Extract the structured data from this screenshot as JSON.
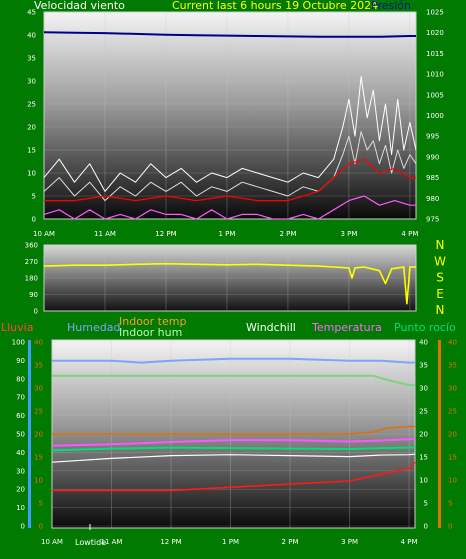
{
  "header": {
    "wind_label": "Velocidad viento",
    "title": "Current last 6 hours 19 Octubre 2024",
    "pressure_label": "Presión"
  },
  "colors": {
    "background": "#007a00",
    "wind": "#ffffff",
    "gust": "#ffffff",
    "wind_low": "#ff55ff",
    "pressure": "#00008b",
    "direction": "#ffff00",
    "avg_line": "#ff0000",
    "humidity": "#7fa3ff",
    "indoor_temp": "#e07000",
    "indoor_hum": "#7fd27f",
    "windchill": "#ffffff",
    "temperature": "#ff55ff",
    "dew_point": "#00e07a",
    "rain_axis": "#ff4444",
    "temp_axis": "#e07000"
  },
  "chart_data": [
    {
      "type": "line",
      "name": "wind-panel",
      "title": "Current last 6 hours 19 Octubre 2024",
      "x_ticks": [
        "10 AM",
        "11 AM",
        "12 PM",
        "1 PM",
        "2 PM",
        "3 PM",
        "4 PM"
      ],
      "y_left": {
        "label": "Velocidad viento",
        "ticks": [
          "45",
          "40",
          "35",
          "30",
          "25",
          "20",
          "15",
          "10",
          "5",
          "0"
        ],
        "lim": [
          0,
          45
        ]
      },
      "y_right": {
        "label": "Presión",
        "ticks": [
          "1025",
          "1020",
          "1015",
          "1010",
          "1005",
          "1000",
          "995",
          "990",
          "985",
          "980",
          "975"
        ],
        "lim": [
          975,
          1025
        ]
      },
      "series": [
        {
          "name": "Presión",
          "axis": "right",
          "x": [
            10,
            10.5,
            11,
            11.5,
            12,
            12.5,
            13,
            13.5,
            14,
            14.5,
            15,
            15.5,
            16,
            16.1
          ],
          "values": [
            1020.1,
            1020.0,
            1019.9,
            1019.7,
            1019.5,
            1019.4,
            1019.3,
            1019.2,
            1019.1,
            1019.0,
            1019.0,
            1019.0,
            1019.2,
            1019.2
          ]
        },
        {
          "name": "Racha",
          "axis": "left",
          "x": [
            10,
            10.25,
            10.5,
            10.75,
            11,
            11.25,
            11.5,
            11.75,
            12,
            12.25,
            12.5,
            12.75,
            13,
            13.25,
            13.5,
            13.75,
            14,
            14.25,
            14.5,
            14.75,
            14.9,
            15.0,
            15.1,
            15.2,
            15.3,
            15.4,
            15.5,
            15.6,
            15.7,
            15.8,
            15.9,
            16,
            16.1
          ],
          "values": [
            9,
            13,
            8,
            12,
            6,
            10,
            8,
            12,
            9,
            11,
            8,
            10,
            9,
            11,
            10,
            9,
            8,
            10,
            9,
            13,
            20,
            26,
            18,
            31,
            22,
            28,
            17,
            25,
            14,
            26,
            15,
            21,
            15
          ]
        },
        {
          "name": "Velocidad media",
          "axis": "left",
          "x": [
            10,
            10.25,
            10.5,
            10.75,
            11,
            11.25,
            11.5,
            11.75,
            12,
            12.25,
            12.5,
            12.75,
            13,
            13.25,
            13.5,
            13.75,
            14,
            14.25,
            14.5,
            14.75,
            14.9,
            15.0,
            15.1,
            15.2,
            15.3,
            15.4,
            15.5,
            15.6,
            15.7,
            15.8,
            15.9,
            16,
            16.1
          ],
          "values": [
            6,
            9,
            5,
            8,
            4,
            7,
            5,
            8,
            6,
            8,
            5,
            7,
            6,
            8,
            7,
            6,
            5,
            7,
            6,
            9,
            14,
            18,
            12,
            19,
            15,
            17,
            12,
            16,
            10,
            15,
            11,
            14,
            12
          ]
        },
        {
          "name": "Promedio",
          "axis": "left",
          "x": [
            10,
            10.5,
            11,
            11.5,
            12,
            12.5,
            13,
            13.5,
            14,
            14.5,
            14.75,
            15,
            15.25,
            15.5,
            15.75,
            16,
            16.1
          ],
          "values": [
            4,
            4,
            5,
            4,
            5,
            4,
            5,
            4,
            4,
            6,
            9,
            12,
            13,
            10,
            11,
            9,
            9
          ]
        },
        {
          "name": "Mínimo",
          "axis": "left",
          "x": [
            10,
            10.25,
            10.5,
            10.75,
            11,
            11.25,
            11.5,
            11.75,
            12,
            12.25,
            12.5,
            12.75,
            13,
            13.25,
            13.5,
            13.75,
            14,
            14.25,
            14.5,
            14.75,
            15,
            15.25,
            15.5,
            15.75,
            16,
            16.1
          ],
          "values": [
            1,
            2,
            0,
            2,
            0,
            1,
            0,
            2,
            1,
            1,
            0,
            2,
            0,
            1,
            1,
            0,
            0,
            1,
            0,
            2,
            4,
            5,
            3,
            4,
            3,
            3
          ]
        }
      ]
    },
    {
      "type": "line",
      "name": "direction-panel",
      "x_ticks": [
        "10 AM",
        "11 AM",
        "12 PM",
        "1 PM",
        "2 PM",
        "3 PM",
        "4 PM"
      ],
      "y_left": {
        "ticks": [
          "360",
          "270",
          "180",
          "90",
          "0"
        ],
        "lim": [
          0,
          360
        ]
      },
      "y_right": {
        "ticks": [
          "N",
          "W",
          "S",
          "E",
          "N"
        ]
      },
      "series": [
        {
          "name": "Dirección",
          "x": [
            10,
            10.5,
            11,
            11.5,
            12,
            12.5,
            13,
            13.5,
            14,
            14.5,
            14.75,
            15,
            15.05,
            15.1,
            15.25,
            15.5,
            15.6,
            15.7,
            15.8,
            15.9,
            15.95,
            16,
            16.1
          ],
          "values": [
            245,
            250,
            250,
            255,
            258,
            255,
            252,
            255,
            250,
            245,
            240,
            235,
            180,
            235,
            240,
            220,
            150,
            230,
            235,
            240,
            40,
            240,
            240
          ]
        }
      ]
    },
    {
      "type": "line",
      "name": "temp-hum-panel",
      "x_ticks": [
        "10 AM",
        "11 AM",
        "12 PM",
        "1 PM",
        "2 PM",
        "3 PM",
        "4 PM"
      ],
      "lowtide_label": "Lowtide",
      "y_axes": {
        "rain": {
          "label": "Lluvia",
          "ticks": [
            "30",
            "25",
            "20",
            "15",
            "10",
            "5",
            "0"
          ],
          "lim": [
            0,
            30
          ]
        },
        "humidity": {
          "label": "Humedad",
          "ticks": [
            "100",
            "90",
            "80",
            "70",
            "60",
            "50",
            "40",
            "30",
            "20",
            "10",
            "0"
          ],
          "lim": [
            0,
            100
          ]
        },
        "temp_left": {
          "ticks": [
            "40",
            "35",
            "30",
            "25",
            "20",
            "15",
            "10",
            "5",
            "0"
          ],
          "lim": [
            0,
            40
          ]
        },
        "temp_right": {
          "ticks": [
            "40",
            "35",
            "30",
            "25",
            "20",
            "15",
            "10",
            "5",
            "0"
          ],
          "lim": [
            0,
            40
          ]
        }
      },
      "legend": [
        "Humedad",
        "Indoor temp",
        "Indoor hum",
        "Windchill",
        "Temperatura",
        "Punto rocío"
      ],
      "series": [
        {
          "name": "Humedad",
          "axis": "humidity",
          "x": [
            10,
            11,
            11.5,
            12,
            13,
            14,
            15,
            15.5,
            16,
            16.1
          ],
          "values": [
            89,
            89,
            88,
            89,
            90,
            90,
            89,
            89,
            88,
            88
          ]
        },
        {
          "name": "Indoor hum",
          "axis": "humidity",
          "x": [
            10,
            11,
            12,
            13,
            14,
            15,
            15.4,
            15.6,
            16,
            16.1
          ],
          "values": [
            81,
            81,
            81,
            81,
            81,
            81,
            81,
            79,
            76,
            76
          ]
        },
        {
          "name": "Indoor temp",
          "axis": "humidity",
          "x": [
            10,
            11,
            12,
            13,
            14,
            15,
            15.4,
            15.6,
            16,
            16.1
          ],
          "values": [
            50,
            50,
            50,
            50,
            50,
            50,
            51,
            53,
            54,
            54
          ]
        },
        {
          "name": "Temperatura",
          "axis": "temp",
          "x": [
            10,
            11,
            12,
            13,
            14,
            15,
            15.5,
            16,
            16.1
          ],
          "values": [
            17.5,
            17.8,
            18.3,
            18.7,
            18.7,
            18.4,
            18.6,
            18.9,
            19.0
          ]
        },
        {
          "name": "Punto rocío",
          "axis": "temp",
          "x": [
            10,
            11,
            12,
            13,
            14,
            15,
            15.5,
            16,
            16.1
          ],
          "values": [
            16.5,
            16.9,
            17.1,
            17.0,
            16.9,
            16.8,
            17.0,
            17.1,
            17.2
          ]
        },
        {
          "name": "Windchill",
          "axis": "temp",
          "x": [
            10,
            11,
            12,
            13,
            14,
            15,
            15.5,
            16,
            16.1
          ],
          "values": [
            14.0,
            14.8,
            15.4,
            15.6,
            15.4,
            15.2,
            15.5,
            15.6,
            15.7
          ]
        },
        {
          "name": "Lluvia",
          "axis": "rain",
          "x": [
            10,
            11,
            12,
            13,
            14,
            15,
            15.5,
            16,
            16.1
          ],
          "values": [
            6,
            6,
            6,
            6.5,
            7,
            7.5,
            8.5,
            9.5,
            10.5
          ]
        }
      ]
    }
  ]
}
